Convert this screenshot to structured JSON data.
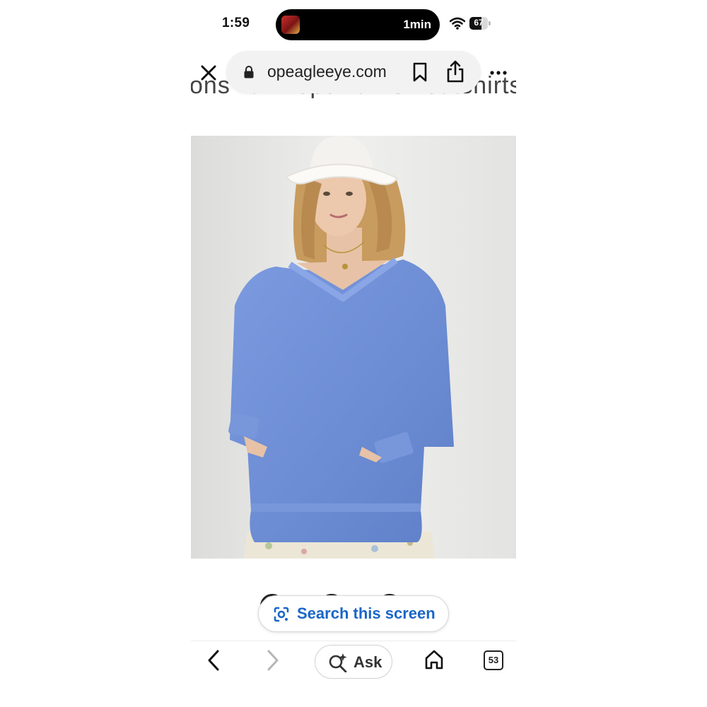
{
  "status_bar": {
    "time": "1:59",
    "timer": "1min",
    "battery_percent": 67
  },
  "browser": {
    "url": "opeagleeye.com",
    "breadcrumb": [
      "ons",
      "Tops",
      "Sweatshirts & T"
    ]
  },
  "product": {
    "image_icon": "product-photo-blue-sweatshirt",
    "carousel_dots": 3
  },
  "search_screen": {
    "label": "Search this screen"
  },
  "toolbar": {
    "ask_label": "Ask",
    "tabs_count": "53"
  },
  "colors": {
    "accent_blue": "#1a66c8",
    "sweatshirt_blue": "#6f8fd6"
  }
}
